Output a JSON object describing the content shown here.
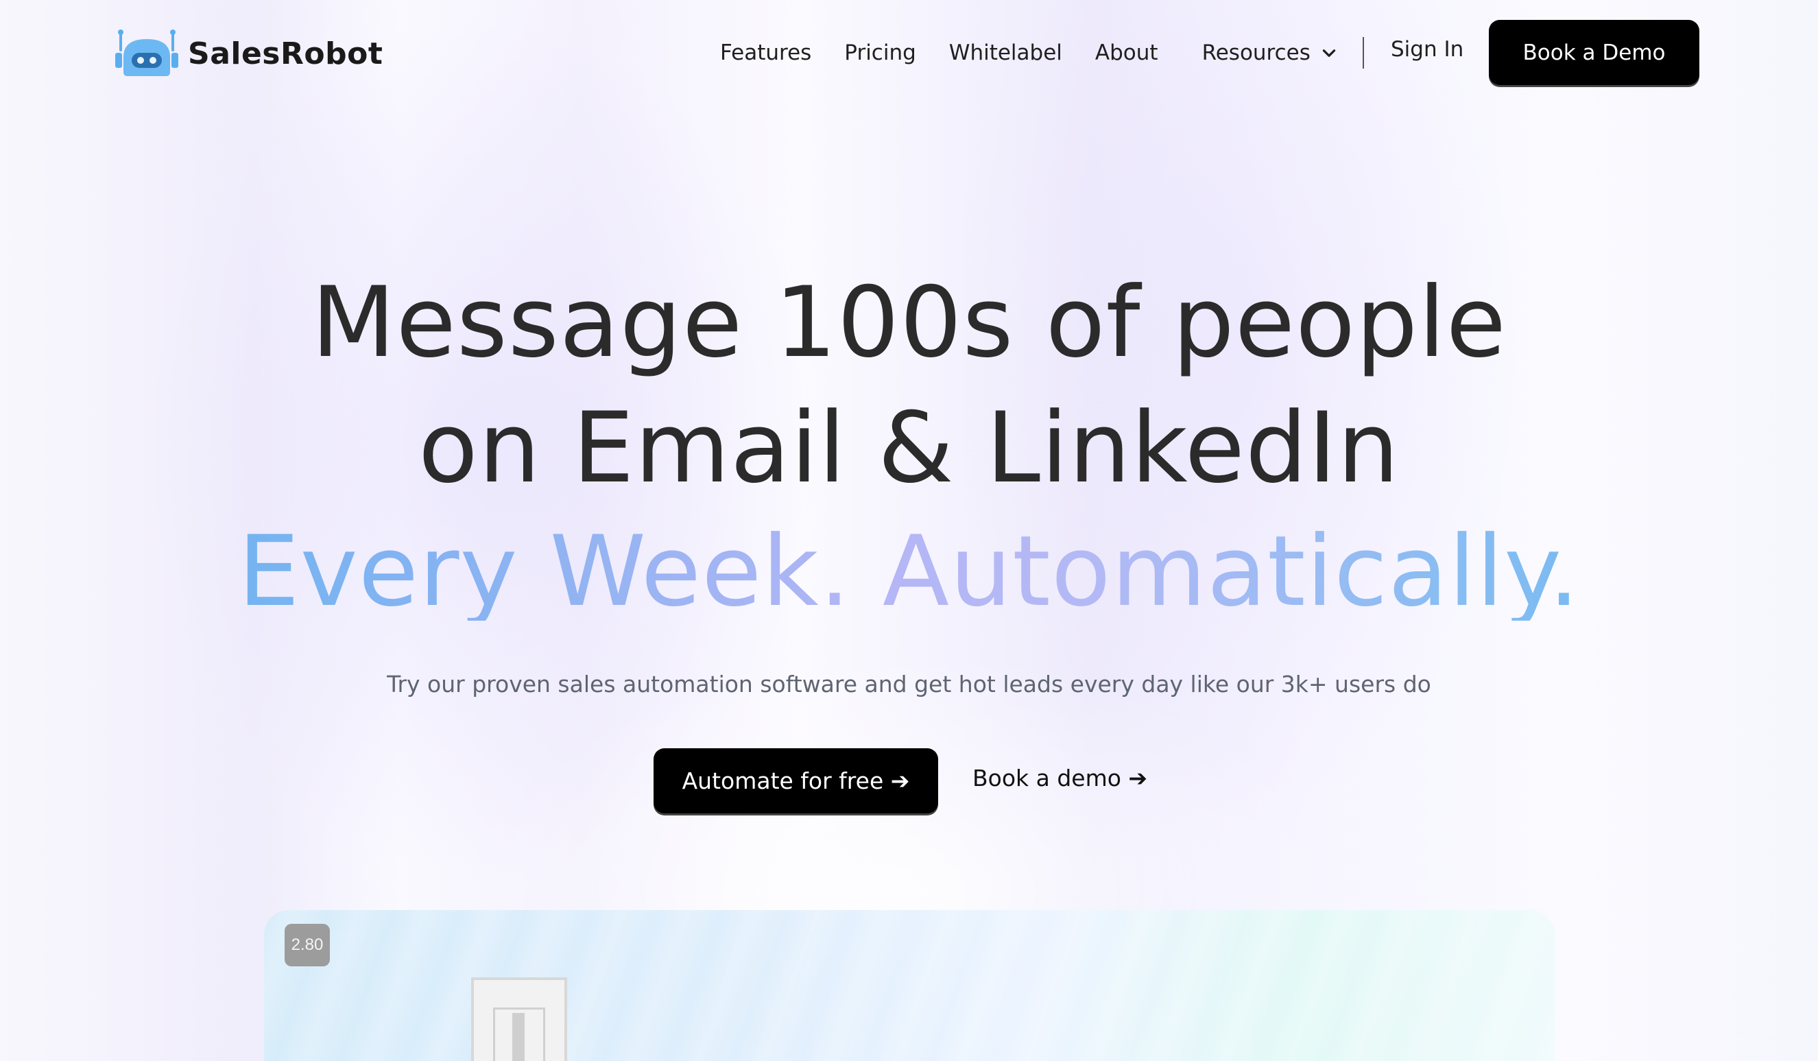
{
  "brand": {
    "name": "SalesRobot",
    "logo_icon": "robot-head-icon",
    "accent_color": "#5fb4f0"
  },
  "nav": {
    "links": [
      "Features",
      "Pricing",
      "Whitelabel",
      "About"
    ],
    "resources_label": "Resources",
    "sign_in_label": "Sign In",
    "book_demo_label": "Book a Demo"
  },
  "hero": {
    "line1": "Message 100s of people",
    "line2": "on Email & LinkedIn",
    "line3": "Every Week. Automatically.",
    "subtitle": "Try our proven sales automation software and get hot leads every day like our 3k+ users do",
    "primary_cta": "Automate for free ➔",
    "secondary_cta": "Book a demo ➔"
  },
  "media": {
    "speed_badge": "2.80"
  }
}
